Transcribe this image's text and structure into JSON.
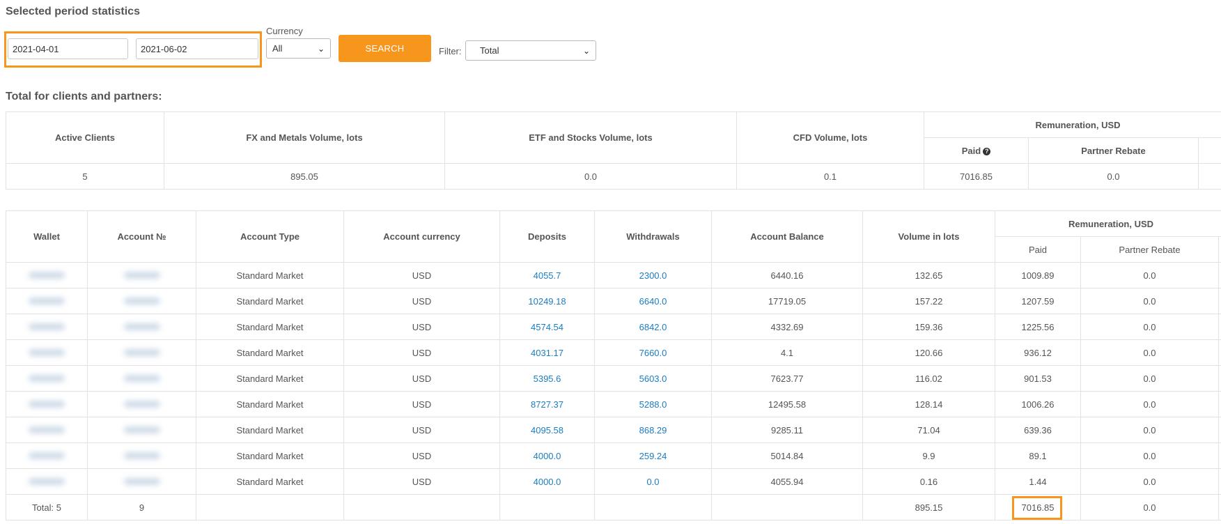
{
  "page": {
    "title": "Selected period statistics",
    "subtitle": "Total for clients and partners:"
  },
  "filters": {
    "date_from": "2021-04-01",
    "date_to": "2021-06-02",
    "currency_label": "Currency",
    "currency_value": "All",
    "search_label": "SEARCH",
    "filter_label": "Filter:",
    "filter_value": "Total"
  },
  "summary": {
    "headers": {
      "active_clients": "Active Clients",
      "fx": "FX and Metals Volume, lots",
      "etf": "ETF and Stocks Volume, lots",
      "cfd": "CFD Volume, lots",
      "remuneration": "Remuneration, USD",
      "paid": "Paid",
      "partner_rebate": "Partner Rebate"
    },
    "values": {
      "active_clients": "5",
      "fx": "895.05",
      "etf": "0.0",
      "cfd": "0.1",
      "paid": "7016.85",
      "partner_rebate": "0.0"
    }
  },
  "detail": {
    "headers": {
      "wallet": "Wallet",
      "account_no": "Account №",
      "account_type": "Account Type",
      "account_currency": "Account currency",
      "deposits": "Deposits",
      "withdrawals": "Withdrawals",
      "balance": "Account Balance",
      "volume": "Volume in lots",
      "remuneration": "Remuneration, USD",
      "paid": "Paid",
      "partner_rebate": "Partner Rebate"
    },
    "rows": [
      {
        "type": "Standard Market",
        "currency": "USD",
        "deposits": "4055.7",
        "withdrawals": "2300.0",
        "balance": "6440.16",
        "volume": "132.65",
        "paid": "1009.89",
        "rebate": "0.0"
      },
      {
        "type": "Standard Market",
        "currency": "USD",
        "deposits": "10249.18",
        "withdrawals": "6640.0",
        "balance": "17719.05",
        "volume": "157.22",
        "paid": "1207.59",
        "rebate": "0.0"
      },
      {
        "type": "Standard Market",
        "currency": "USD",
        "deposits": "4574.54",
        "withdrawals": "6842.0",
        "balance": "4332.69",
        "volume": "159.36",
        "paid": "1225.56",
        "rebate": "0.0"
      },
      {
        "type": "Standard Market",
        "currency": "USD",
        "deposits": "4031.17",
        "withdrawals": "7660.0",
        "balance": "4.1",
        "volume": "120.66",
        "paid": "936.12",
        "rebate": "0.0"
      },
      {
        "type": "Standard Market",
        "currency": "USD",
        "deposits": "5395.6",
        "withdrawals": "5603.0",
        "balance": "7623.77",
        "volume": "116.02",
        "paid": "901.53",
        "rebate": "0.0"
      },
      {
        "type": "Standard Market",
        "currency": "USD",
        "deposits": "8727.37",
        "withdrawals": "5288.0",
        "balance": "12495.58",
        "volume": "128.14",
        "paid": "1006.26",
        "rebate": "0.0"
      },
      {
        "type": "Standard Market",
        "currency": "USD",
        "deposits": "4095.58",
        "withdrawals": "868.29",
        "balance": "9285.11",
        "volume": "71.04",
        "paid": "639.36",
        "rebate": "0.0"
      },
      {
        "type": "Standard Market",
        "currency": "USD",
        "deposits": "4000.0",
        "withdrawals": "259.24",
        "balance": "5014.84",
        "volume": "9.9",
        "paid": "89.1",
        "rebate": "0.0"
      },
      {
        "type": "Standard Market",
        "currency": "USD",
        "deposits": "4000.0",
        "withdrawals": "0.0",
        "balance": "4055.94",
        "volume": "0.16",
        "paid": "1.44",
        "rebate": "0.0"
      }
    ],
    "total": {
      "label": "Total: 5",
      "accounts": "9",
      "volume": "895.15",
      "paid": "7016.85",
      "rebate": "0.0"
    }
  },
  "colors": {
    "accent": "#f7961d",
    "link": "#1a7dc2"
  },
  "icons": {
    "help": "question-circle-icon",
    "dropdown": "chevron-down-icon"
  }
}
